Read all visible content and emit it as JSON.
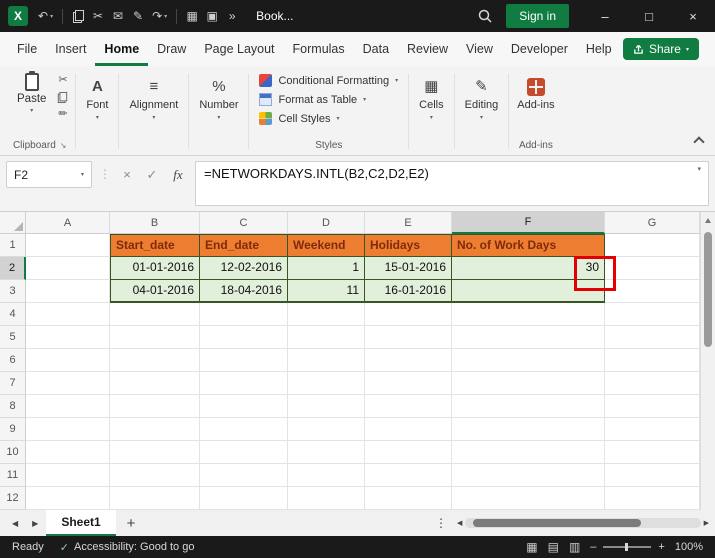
{
  "icons": {
    "excel_logo": "X",
    "caret_down": "▾",
    "undo": "↶",
    "redo": "↷",
    "cut": "✂",
    "mail": "✉",
    "pen": "✎",
    "painter": "✏",
    "grid": "▦",
    "window": "▣",
    "more": "»",
    "minimize": "–",
    "maximize": "□",
    "close": "×",
    "cancel": "×",
    "check": "✓",
    "dots_vertical": "⋮",
    "dialog_launcher": "↘",
    "font": "A",
    "alignment": "≡",
    "number": "%",
    "cells": "▦",
    "editing": "✎",
    "left_arrow": "◀",
    "right_arrow": "▶",
    "plus": "+",
    "accessibility": "✓",
    "view_normal": "▦",
    "view_layout": "▤",
    "view_break": "▥",
    "zoom_minus": "–",
    "zoom_plus": "+"
  },
  "titlebar": {
    "doc_title": "Book...",
    "sign_in_label": "Sign in"
  },
  "menubar": {
    "items": [
      "File",
      "Insert",
      "Home",
      "Draw",
      "Page Layout",
      "Formulas",
      "Data",
      "Review",
      "View",
      "Developer",
      "Help"
    ],
    "active": "Home",
    "share_label": "Share"
  },
  "ribbon": {
    "paste_label": "Paste",
    "clipboard_label": "Clipboard",
    "font_label": "Font",
    "alignment_label": "Alignment",
    "number_label": "Number",
    "styles_buttons": [
      "Conditional Formatting",
      "Format as Table",
      "Cell Styles"
    ],
    "styles_label": "Styles",
    "cells_label": "Cells",
    "editing_label": "Editing",
    "addins_label": "Add-ins",
    "addins_group_label": "Add-ins"
  },
  "formula_bar": {
    "name_box": "F2",
    "insert_function": "fx",
    "formula": "=NETWORKDAYS.INTL(B2,C2,D2,E2)"
  },
  "grid": {
    "columns": [
      "A",
      "B",
      "C",
      "D",
      "E",
      "F",
      "G"
    ],
    "rows": [
      "1",
      "2",
      "3",
      "4",
      "5",
      "6",
      "7",
      "8",
      "9",
      "10",
      "11",
      "12"
    ],
    "selected_column": "F",
    "selected_row": "2",
    "selected_cell": "F2",
    "table": {
      "origin": "B1",
      "headers": [
        "Start_date",
        "End_date",
        "Weekend",
        "Holidays",
        "No. of Work Days"
      ],
      "rows": [
        [
          "01-01-2016",
          "12-02-2016",
          "1",
          "15-01-2016",
          "30"
        ],
        [
          "04-01-2016",
          "18-04-2016",
          "11",
          "16-01-2016",
          ""
        ]
      ]
    },
    "colors": {
      "header_fill": "#ED7D31",
      "header_text": "#7F2B0A",
      "data_fill": "#E2EFDA",
      "table_border": "#375623",
      "annotation": "#E30000",
      "accent": "#107C41"
    }
  },
  "sheet_tabs": {
    "tabs": [
      "Sheet1"
    ],
    "active": "Sheet1"
  },
  "status_bar": {
    "ready_label": "Ready",
    "accessibility_label": "Accessibility: Good to go",
    "zoom_value": "100%"
  }
}
